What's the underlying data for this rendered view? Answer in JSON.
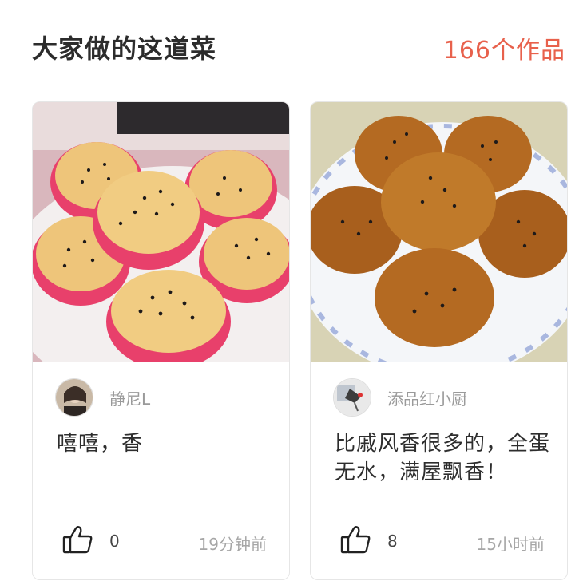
{
  "header": {
    "title": "大家做的这道菜",
    "works_count": "166个作品"
  },
  "cards": [
    {
      "author": "静尼L",
      "comment": "嘻嘻，香",
      "likes": "0",
      "time": "19分钟前"
    },
    {
      "author": "添品红小厨",
      "comment": "比戚风香很多的，全蛋无水，满屋飘香！",
      "likes": "8",
      "time": "15小时前"
    }
  ],
  "colors": {
    "accent": "#e8614c",
    "muted_text": "#9a9a9a"
  },
  "icons": [
    "thumbs-up-icon"
  ]
}
